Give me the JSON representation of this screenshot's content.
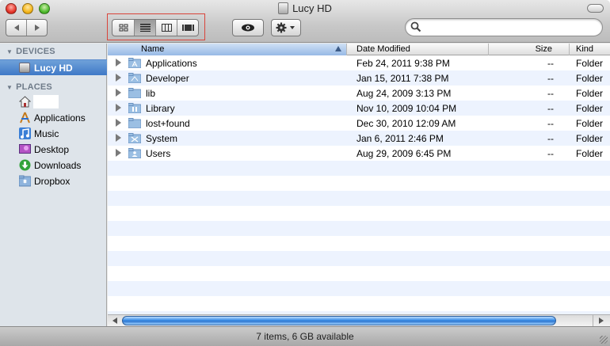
{
  "window": {
    "title": "Lucy HD"
  },
  "toolbar": {
    "back_icon": "back-arrow-icon",
    "forward_icon": "forward-arrow-icon",
    "view_modes": [
      "icon-view",
      "list-view",
      "column-view",
      "coverflow-view"
    ],
    "active_view": "list-view",
    "search": {
      "value": "",
      "placeholder": ""
    }
  },
  "sidebar": {
    "devices_header": "DEVICES",
    "places_header": "PLACES",
    "devices": [
      {
        "label": "Lucy HD",
        "icon": "hard-disk-icon",
        "selected": true
      }
    ],
    "places": [
      {
        "label": "",
        "icon": "home-icon"
      },
      {
        "label": "Applications",
        "icon": "applications-icon"
      },
      {
        "label": "Music",
        "icon": "music-note-icon"
      },
      {
        "label": "Desktop",
        "icon": "desktop-icon"
      },
      {
        "label": "Downloads",
        "icon": "downloads-icon"
      },
      {
        "label": "Dropbox",
        "icon": "dropbox-folder-icon"
      }
    ]
  },
  "list": {
    "columns": {
      "name": "Name",
      "date": "Date Modified",
      "size": "Size",
      "kind": "Kind"
    },
    "sort_column": "name",
    "rows": [
      {
        "name": "Applications",
        "date": "Feb 24, 2011 9:38 PM",
        "size": "--",
        "kind": "Folder",
        "icon": "applications-folder-icon"
      },
      {
        "name": "Developer",
        "date": "Jan 15, 2011 7:38 PM",
        "size": "--",
        "kind": "Folder",
        "icon": "developer-folder-icon"
      },
      {
        "name": "lib",
        "date": "Aug 24, 2009 3:13 PM",
        "size": "--",
        "kind": "Folder",
        "icon": "folder-icon"
      },
      {
        "name": "Library",
        "date": "Nov 10, 2009 10:04 PM",
        "size": "--",
        "kind": "Folder",
        "icon": "library-folder-icon"
      },
      {
        "name": "lost+found",
        "date": "Dec 30, 2010 12:09 AM",
        "size": "--",
        "kind": "Folder",
        "icon": "folder-icon"
      },
      {
        "name": "System",
        "date": "Jan 6, 2011 2:46 PM",
        "size": "--",
        "kind": "Folder",
        "icon": "system-folder-icon"
      },
      {
        "name": "Users",
        "date": "Aug 29, 2009 6:45 PM",
        "size": "--",
        "kind": "Folder",
        "icon": "users-folder-icon"
      }
    ]
  },
  "status": {
    "text": "7 items, 6 GB available"
  },
  "colors": {
    "selection": "#3f79c7",
    "alt_row": "#edf3fe",
    "sidebar_bg": "#dee4ea",
    "highlight_box": "#d9443b"
  }
}
